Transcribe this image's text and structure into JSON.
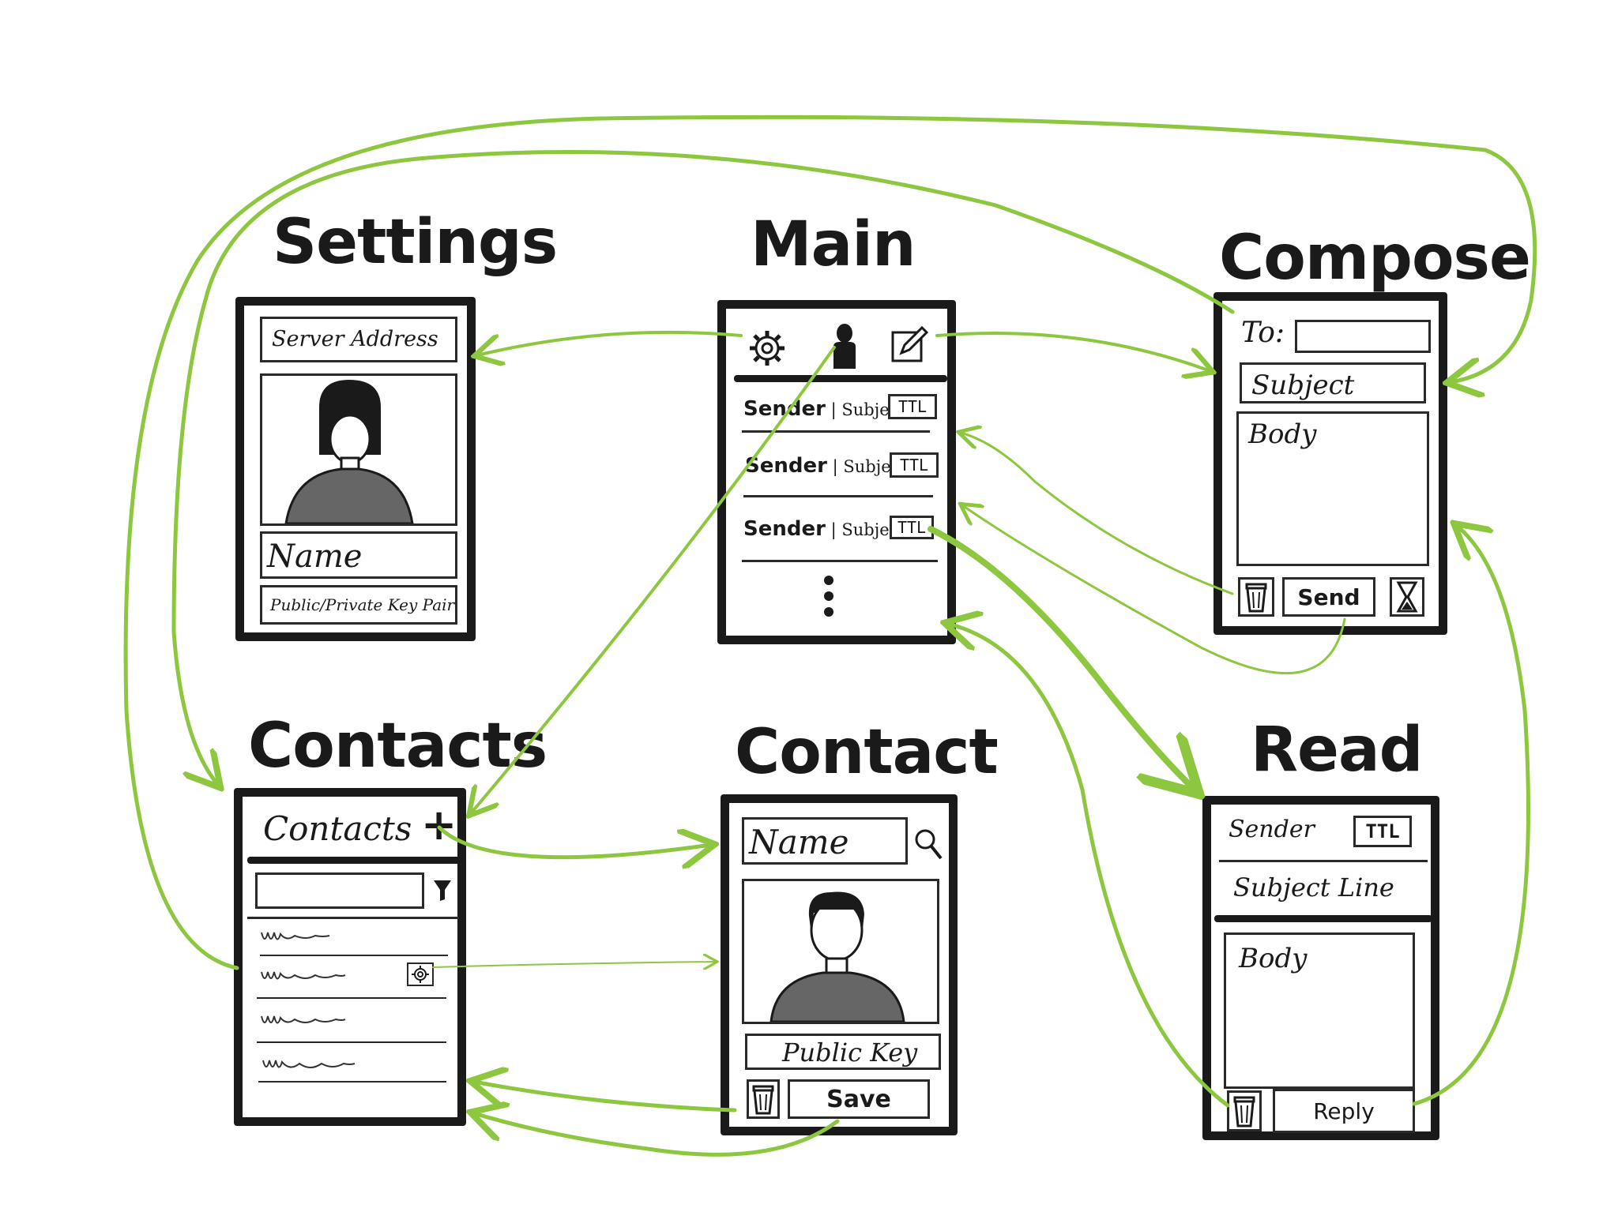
{
  "colors": {
    "arrow": "#8dc63f",
    "ink": "#1a1a1a"
  },
  "screens": {
    "settings": {
      "title": "Settings",
      "server_address": "Server Address",
      "name": "Name",
      "key_pair": "Public/Private Key Pair"
    },
    "main": {
      "title": "Main",
      "toolbar_icons": [
        "gear-icon",
        "person-icon",
        "compose-icon"
      ],
      "messages": [
        {
          "sender": "Sender",
          "subject": "Subject",
          "ttl": "TTL"
        },
        {
          "sender": "Sender",
          "subject": "Subjed",
          "ttl": "TTL"
        },
        {
          "sender": "Sender",
          "subject": "Subject",
          "ttl": "TTL"
        }
      ]
    },
    "compose": {
      "title": "Compose",
      "to_label": "To:",
      "subject": "Subject",
      "body": "Body",
      "send": "Send"
    },
    "contacts": {
      "title": "Contacts",
      "header": "Contacts",
      "add": "+"
    },
    "contact": {
      "title": "Contact",
      "name": "Name",
      "public_key": "Public Key",
      "save": "Save"
    },
    "read": {
      "title": "Read",
      "sender": "Sender",
      "ttl": "TTL",
      "subject_line": "Subject Line",
      "body": "Body",
      "reply": "Reply"
    }
  }
}
